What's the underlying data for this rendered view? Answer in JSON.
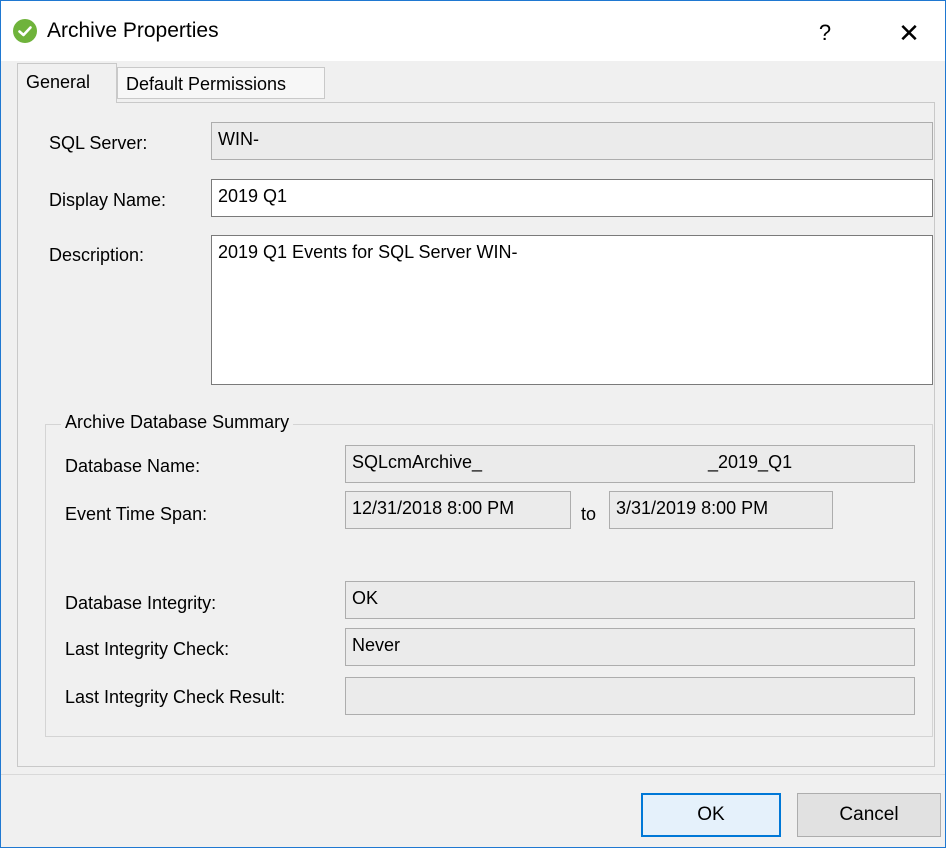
{
  "window": {
    "title": "Archive Properties",
    "help_glyph": "?",
    "close_glyph": "✕"
  },
  "tabs": [
    {
      "label": "General",
      "active": true
    },
    {
      "label": "Default Permissions",
      "active": false
    }
  ],
  "general": {
    "sql_server_label": "SQL Server:",
    "sql_server_value": "WIN-",
    "display_name_label": "Display Name:",
    "display_name_value": "2019 Q1",
    "description_label": "Description:",
    "description_value": "2019 Q1 Events for SQL Server WIN-"
  },
  "summary": {
    "group_title": "Archive Database Summary",
    "database_name_label": "Database Name:",
    "database_name_value": "SQLcmArchive_",
    "database_name_suffix": "_2019_Q1",
    "event_time_span_label": "Event Time Span:",
    "span_from": "12/31/2018 8:00 PM",
    "span_to_label": "to",
    "span_to": "3/31/2019 8:00 PM",
    "integrity_label": "Database Integrity:",
    "integrity_value": "OK",
    "last_check_label": "Last Integrity Check:",
    "last_check_value": "Never",
    "last_result_label": "Last Integrity Check Result:",
    "last_result_value": ""
  },
  "buttons": {
    "ok": "OK",
    "cancel": "Cancel"
  },
  "colors": {
    "accent": "#0078d7",
    "app_icon": "#6fb33b"
  },
  "icons": {
    "app": "checkmark-circle-icon"
  }
}
